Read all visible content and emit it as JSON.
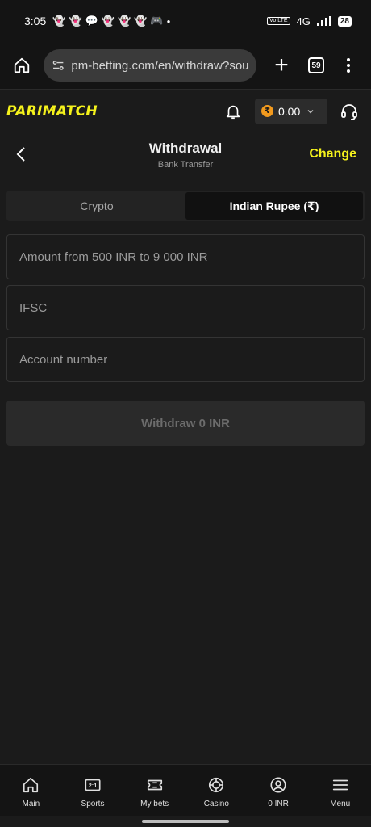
{
  "status_bar": {
    "time": "3:05",
    "network": "4G",
    "volte": "Vo LTE",
    "battery": "28"
  },
  "browser": {
    "url": "pm-betting.com/en/withdraw?source",
    "tab_count": "59"
  },
  "header": {
    "logo": "PARIMATCH",
    "balance": "0.00",
    "currency_symbol": "₹"
  },
  "page": {
    "title": "Withdrawal",
    "subtitle": "Bank Transfer",
    "change_label": "Change"
  },
  "currency_tabs": [
    {
      "label": "Crypto",
      "active": false
    },
    {
      "label": "Indian Rupee (₹)",
      "active": true
    }
  ],
  "form": {
    "amount_placeholder": "Amount from 500 INR to 9 000 INR",
    "ifsc_placeholder": "IFSC",
    "account_placeholder": "Account number",
    "submit_label": "Withdraw 0 INR"
  },
  "bottom_nav": [
    {
      "label": "Main",
      "icon": "home-icon"
    },
    {
      "label": "Sports",
      "icon": "sports-icon"
    },
    {
      "label": "My bets",
      "icon": "ticket-icon"
    },
    {
      "label": "Casino",
      "icon": "chip-icon"
    },
    {
      "label": "0 INR",
      "icon": "user-icon"
    },
    {
      "label": "Menu",
      "icon": "menu-icon"
    }
  ],
  "colors": {
    "accent": "#f5f21c",
    "background": "#1b1b1b",
    "coin": "#f29a1e"
  }
}
